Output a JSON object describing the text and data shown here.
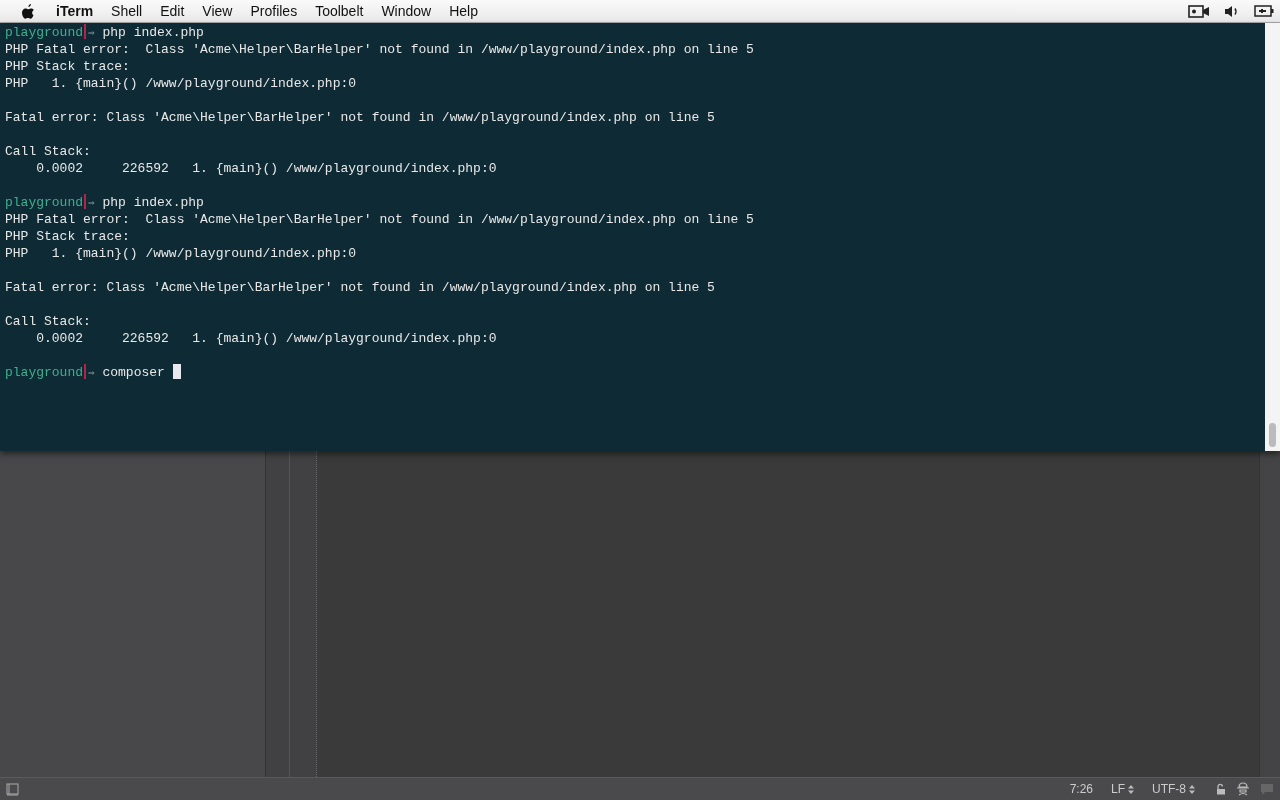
{
  "menu_bar": {
    "app_name": "iTerm",
    "items": [
      "Shell",
      "Edit",
      "View",
      "Profiles",
      "Toolbelt",
      "Window",
      "Help"
    ]
  },
  "terminal": {
    "lines": [
      {
        "kind": "prompt",
        "directory": "playground",
        "symbol": "⇒",
        "command": "php index.php",
        "cursor": false
      },
      {
        "kind": "output",
        "text": "PHP Fatal error:  Class 'Acme\\Helper\\BarHelper' not found in /www/playground/index.php on line 5"
      },
      {
        "kind": "output",
        "text": "PHP Stack trace:"
      },
      {
        "kind": "output",
        "text": "PHP   1. {main}() /www/playground/index.php:0"
      },
      {
        "kind": "blank"
      },
      {
        "kind": "output",
        "text": "Fatal error: Class 'Acme\\Helper\\BarHelper' not found in /www/playground/index.php on line 5"
      },
      {
        "kind": "blank"
      },
      {
        "kind": "output",
        "text": "Call Stack:"
      },
      {
        "kind": "output",
        "text": "    0.0002     226592   1. {main}() /www/playground/index.php:0"
      },
      {
        "kind": "blank"
      },
      {
        "kind": "prompt",
        "directory": "playground",
        "symbol": "⇒",
        "command": "php index.php",
        "cursor": false
      },
      {
        "kind": "output",
        "text": "PHP Fatal error:  Class 'Acme\\Helper\\BarHelper' not found in /www/playground/index.php on line 5"
      },
      {
        "kind": "output",
        "text": "PHP Stack trace:"
      },
      {
        "kind": "output",
        "text": "PHP   1. {main}() /www/playground/index.php:0"
      },
      {
        "kind": "blank"
      },
      {
        "kind": "output",
        "text": "Fatal error: Class 'Acme\\Helper\\BarHelper' not found in /www/playground/index.php on line 5"
      },
      {
        "kind": "blank"
      },
      {
        "kind": "output",
        "text": "Call Stack:"
      },
      {
        "kind": "output",
        "text": "    0.0002     226592   1. {main}() /www/playground/index.php:0"
      },
      {
        "kind": "blank"
      },
      {
        "kind": "prompt",
        "directory": "playground",
        "symbol": "⇒",
        "command": "composer",
        "cursor": true
      }
    ]
  },
  "status_bar": {
    "position": "7:26",
    "line_ending": "LF",
    "encoding": "UTF-8"
  }
}
